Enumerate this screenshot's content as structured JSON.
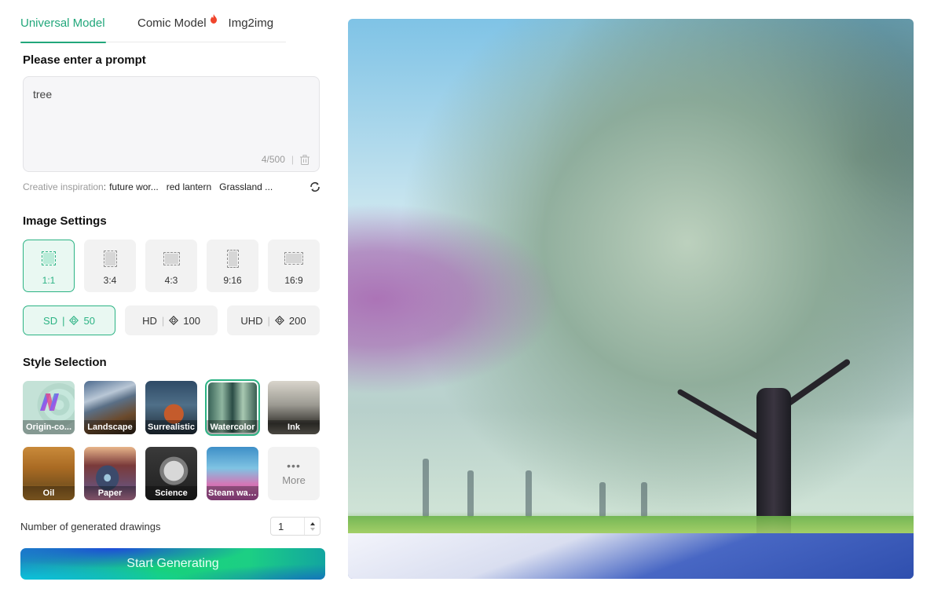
{
  "tabs": [
    {
      "label": "Universal Model",
      "active": true
    },
    {
      "label": "Comic Model",
      "active": false,
      "badge_icon": "fire-icon"
    },
    {
      "label": "Img2img",
      "active": false
    }
  ],
  "prompt": {
    "heading": "Please enter a prompt",
    "value": "tree",
    "char_count": "4/500",
    "separator": "|"
  },
  "inspiration": {
    "label": "Creative inspiration",
    "colon": ":",
    "chips": [
      "future wor...",
      "red lantern",
      "Grassland ..."
    ]
  },
  "image_settings": {
    "heading": "Image Settings",
    "ratios": [
      {
        "label": "1:1",
        "active": true
      },
      {
        "label": "3:4",
        "active": false
      },
      {
        "label": "4:3",
        "active": false
      },
      {
        "label": "9:16",
        "active": false
      },
      {
        "label": "16:9",
        "active": false
      }
    ],
    "qualities": [
      {
        "label": "SD",
        "cost": "50",
        "active": true
      },
      {
        "label": "HD",
        "cost": "100",
        "active": false
      },
      {
        "label": "UHD",
        "cost": "200",
        "active": false
      }
    ],
    "separator": "|"
  },
  "style_selection": {
    "heading": "Style Selection",
    "styles": [
      {
        "label": "Origin-co...",
        "active": false
      },
      {
        "label": "Landscape",
        "active": false
      },
      {
        "label": "Surrealistic",
        "active": false
      },
      {
        "label": "Watercolor",
        "active": true
      },
      {
        "label": "Ink",
        "active": false
      },
      {
        "label": "Oil",
        "active": false
      },
      {
        "label": "Paper",
        "active": false
      },
      {
        "label": "Science",
        "active": false
      },
      {
        "label": "Steam wave",
        "active": false
      }
    ],
    "more_dots": "•••",
    "more_label": "More"
  },
  "count": {
    "label": "Number of generated drawings",
    "value": "1"
  },
  "generate_button": "Start Generating",
  "colors": {
    "accent": "#22a77b",
    "active_bg": "#e9f8f2",
    "fire": "#f0452c"
  }
}
